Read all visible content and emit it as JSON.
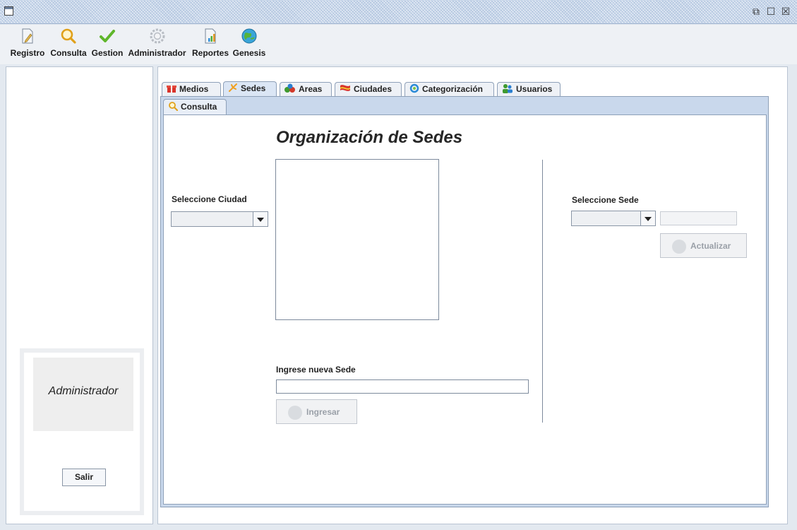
{
  "toolbar": {
    "items": [
      {
        "label": "Registro",
        "icon": "document-edit-icon"
      },
      {
        "label": "Consulta",
        "icon": "magnifier-icon"
      },
      {
        "label": "Gestion",
        "icon": "checkmark-icon"
      },
      {
        "label": "Administrador",
        "icon": "gear-icon"
      },
      {
        "label": "Reportes",
        "icon": "report-chart-icon"
      },
      {
        "label": "Genesis",
        "icon": "globe-icon"
      }
    ]
  },
  "window_controls": {
    "restore": "⧉",
    "maximize": "☐",
    "close": "☒"
  },
  "left": {
    "user_label": "Administrador",
    "exit_label": "Salir"
  },
  "tabs": [
    {
      "label": "Medios",
      "icon": "gift-icon"
    },
    {
      "label": "Sedes",
      "icon": "star-icon",
      "active": true
    },
    {
      "label": "Areas",
      "icon": "shapes-icon"
    },
    {
      "label": "Ciudades",
      "icon": "flag-icon"
    },
    {
      "label": "Categorización",
      "icon": "refresh-icon"
    },
    {
      "label": "Usuarios",
      "icon": "users-icon"
    }
  ],
  "subtab": {
    "label": "Consulta"
  },
  "form": {
    "title": "Organización de Sedes",
    "city_label": "Seleccione Ciudad",
    "city_value": "",
    "sede_label": "Seleccione Sede",
    "sede_value": "",
    "sede_text": "",
    "update_button": "Actualizar",
    "new_label": "Ingrese nueva Sede",
    "new_value": "",
    "insert_button": "Ingresar"
  },
  "colors": {
    "accent": "#c9d8ec",
    "title_bar": "#c7d6ea",
    "panel_border": "#8ea0b8"
  }
}
